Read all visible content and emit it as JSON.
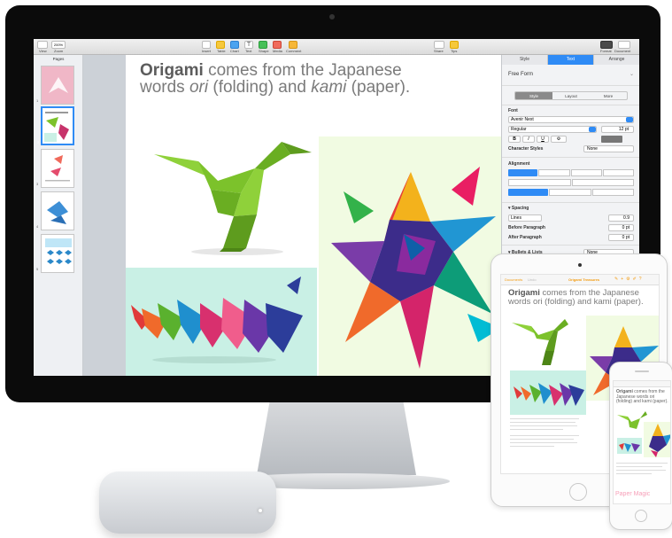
{
  "toolbar": {
    "view_label": "View",
    "zoom_value": "200%",
    "zoom_label": "Zoom",
    "insert_label": "Insert",
    "table_label": "Table",
    "chart_label": "Chart",
    "text_label": "Text",
    "shape_label": "Shape",
    "media_label": "Media",
    "comment_label": "Comment",
    "share_label": "Share",
    "tips_label": "Tips",
    "format_label": "Format",
    "document_label": "Document"
  },
  "sidebar": {
    "title": "Pages",
    "thumbnails": [
      {
        "number": "1"
      },
      {
        "number": "2"
      },
      {
        "number": "3"
      },
      {
        "number": "4"
      },
      {
        "number": "5"
      }
    ]
  },
  "document": {
    "title_bold": "Origami",
    "title_rest_1": " comes from the Japanese",
    "title_line2_a": "words ",
    "title_ori": "ori",
    "title_line2_b": " (folding) and ",
    "title_kami": "kami",
    "title_line2_c": " (paper)."
  },
  "inspector": {
    "tabs": [
      "Style",
      "Text",
      "Arrange"
    ],
    "active_tab": "Text",
    "paragraph_style": "Free Form",
    "subtabs": [
      "Style",
      "Layout",
      "More"
    ],
    "font_header": "Font",
    "font_family": "Avenir Next",
    "font_weight": "Regular",
    "font_size": "12 pt",
    "format_buttons": [
      "B",
      "I",
      "U"
    ],
    "character_styles_label": "Character Styles",
    "character_styles_value": "None",
    "alignment_header": "Alignment",
    "spacing_header": "Spacing",
    "spacing_mode": "Lines",
    "spacing_value": "0.9",
    "before_paragraph_label": "Before Paragraph",
    "before_paragraph_value": "0 pt",
    "after_paragraph_label": "After Paragraph",
    "after_paragraph_value": "0 pt",
    "bullets_label": "Bullets & Lists",
    "bullets_value": "None"
  },
  "ipad": {
    "status_time": "9:41 AM",
    "toolbar_left": "Documents",
    "toolbar_undo": "Undo",
    "doc_name": "Origami Treasures",
    "title_bold": "Origami",
    "title_rest": " comes from the Japanese words ori (folding) and kami (paper)."
  },
  "iphone": {
    "title_bold": "Origami",
    "title_rest": " comes from the Japanese words ori (folding) and kami (paper).",
    "caption": "Paper Magic"
  },
  "colors": {
    "accent_blue": "#2f8bf5",
    "mint_panel": "#c9f0e5",
    "green_bird": "#7cc22b",
    "pink_caption": "#f7a0b9"
  }
}
